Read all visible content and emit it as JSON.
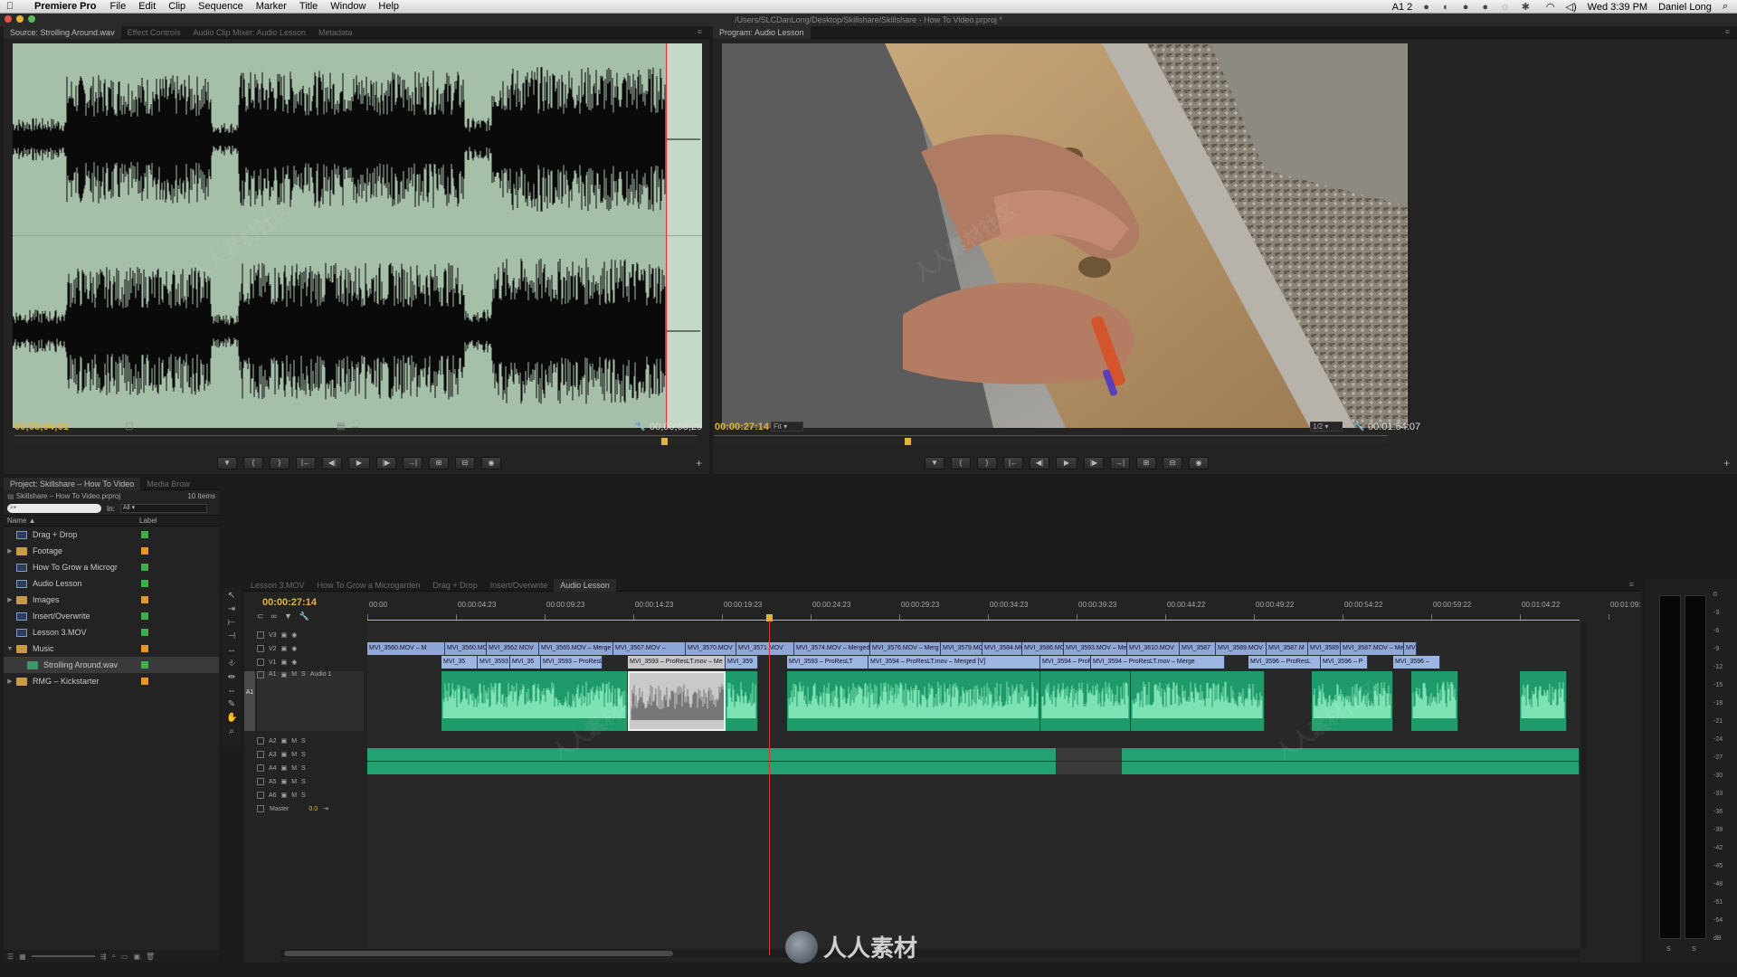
{
  "menubar": {
    "app_name": "Premiere Pro",
    "menus": [
      "File",
      "Edit",
      "Clip",
      "Sequence",
      "Marker",
      "Title",
      "Window",
      "Help"
    ],
    "clock": "Wed 3:39 PM",
    "user": "Daniel Long",
    "input_indicator": "A1 2"
  },
  "window": {
    "path": "/Users/SLCDanLong/Desktop/Skillshare/Skillshare - How To Video.prproj *"
  },
  "source": {
    "tabs": [
      "Source: Strolling Around.wav",
      "Effect Controls",
      "Audio Clip Mixer: Audio Lesson",
      "Metadata"
    ],
    "timecode_in": "00;03;04;01",
    "timecode_duration": "00;00;08;29"
  },
  "program": {
    "tab": "Program: Audio Lesson",
    "timecode_in": "00:00:27:14",
    "zoom": "Fit",
    "resolution": "1/2",
    "timecode_duration": "00:01:54:07"
  },
  "project": {
    "tabs": [
      "Project: Skillshare – How To Video",
      "Media Brow"
    ],
    "file": "Skillshare – How To Video.prproj",
    "count": "10 Items",
    "in_label": "In:",
    "in_value": "All",
    "col_name": "Name",
    "col_label": "Label",
    "items": [
      {
        "name": "Drag + Drop",
        "type": "seq",
        "color": "#3fae49",
        "indent": 0
      },
      {
        "name": "Footage",
        "type": "folder",
        "color": "#e8952a",
        "indent": 0
      },
      {
        "name": "How To Grow a Microgr",
        "type": "seq",
        "color": "#3fae49",
        "indent": 0
      },
      {
        "name": "Audio Lesson",
        "type": "seq",
        "color": "#3fae49",
        "indent": 0
      },
      {
        "name": "Images",
        "type": "folder",
        "color": "#e8952a",
        "indent": 0
      },
      {
        "name": "Insert/Overwrite",
        "type": "seq",
        "color": "#3fae49",
        "indent": 0
      },
      {
        "name": "Lesson 3.MOV",
        "type": "seq",
        "color": "#3fae49",
        "indent": 0
      },
      {
        "name": "Music",
        "type": "folder-open",
        "color": "#e8952a",
        "indent": 0
      },
      {
        "name": "Strolling Around.wav",
        "type": "audio",
        "color": "#3fae49",
        "indent": 1
      },
      {
        "name": "RMG – Kickstarter",
        "type": "folder",
        "color": "#e8952a",
        "indent": 0
      }
    ]
  },
  "timeline": {
    "tabs": [
      "Lesson 3.MOV",
      "How To Grow a Microgarden",
      "Drag + Drop",
      "Insert/Overwrite",
      "Audio Lesson"
    ],
    "timecode": "00:00:27:14",
    "ruler": [
      "00:00",
      "00:00:04:23",
      "00:00:09:23",
      "00:00:14:23",
      "00:00:19:23",
      "00:00:24:23",
      "00:00:29:23",
      "00:00:34:23",
      "00:00:39:23",
      "00:00:44:22",
      "00:00:49:22",
      "00:00:54:22",
      "00:00:59:22",
      "00:01:04:22",
      "00:01:09:22"
    ],
    "tracks": {
      "v3": "V3",
      "v2": "V2",
      "v1": "V1",
      "a1": "A1",
      "a1_name": "Audio 1",
      "a1_src": "A1",
      "a2": "A2",
      "a3": "A3",
      "a4": "A4",
      "a5": "A5",
      "a6": "A6",
      "master": "Master",
      "master_val": "0.0"
    },
    "v2_clips": [
      "MVI_3560.MOV – M",
      "MVI_3560.MO",
      "MVI_3562.MOV",
      "MVI_3565.MOV – Merge",
      "MVI_3567.MOV –",
      "MVI_3570.MOV",
      "MVI_3571.MOV",
      "MVI_3574.MOV – Merged",
      "MVI_3576.MOV – Merg",
      "MVI_3579.MO",
      "MVI_3584.MO",
      "MVI_3586.MO",
      "MVI_3593.MOV – Me",
      "MVI_3610.MOV",
      "MVI_3587",
      "MVI_3589.MOV",
      "MVI_3587.M",
      "MVI_3589",
      "MVI_3587.MOV – Me",
      "MV"
    ],
    "v1_clips": [
      "MVI_35",
      "MVI_3593",
      "MVI_35",
      "MVI_3593 – ProResLT",
      "MVI_3593 – ProResLT.mov – Me",
      "MVI_359",
      "MVI_3593 – ProResLT",
      "MVI_3594 – ProResLT.mov – Merged [V]",
      "MVI_3594 – ProR",
      "MVI_3594 – ProResLT.mov – Merge",
      "MVI_3596 – ProResL",
      "MVI_3596 – P",
      "MVI_3596 –"
    ]
  },
  "meter": {
    "scale": [
      "0",
      "-3",
      "-6",
      "-9",
      "-12",
      "-15",
      "-18",
      "-21",
      "-24",
      "-27",
      "-30",
      "-33",
      "-36",
      "-39",
      "-42",
      "-45",
      "-48",
      "-51",
      "-54",
      "dB"
    ],
    "solo": [
      "S",
      "S"
    ]
  },
  "watermark": {
    "logo_text": "人人素材",
    "overlay": "人人素材社区"
  }
}
